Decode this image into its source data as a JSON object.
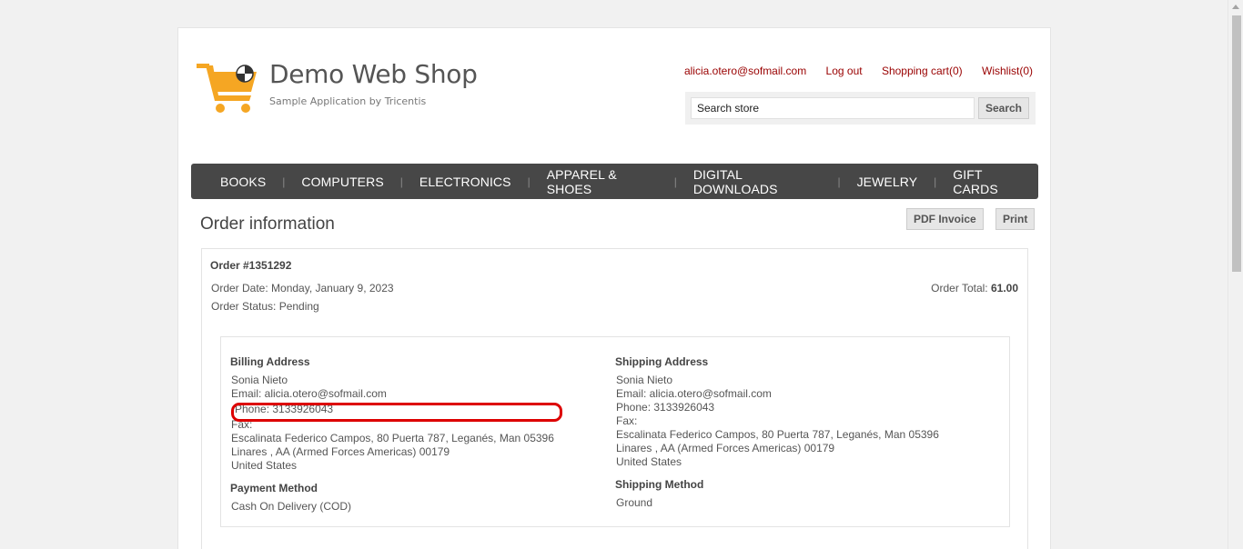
{
  "brand": {
    "title": "Demo Web Shop",
    "subtitle": "Sample Application by Tricentis",
    "logo_icon": "shopping-cart-icon",
    "accent_color": "#f5a623"
  },
  "header": {
    "account_email": "alicia.otero@sofmail.com",
    "logout": "Log out",
    "cart": "Shopping cart(0)",
    "wishlist": "Wishlist(0)",
    "link_color": "#990000"
  },
  "search": {
    "value": "Search store",
    "button": "Search"
  },
  "menu": {
    "items": [
      {
        "label": "BOOKS"
      },
      {
        "label": "COMPUTERS"
      },
      {
        "label": "ELECTRONICS"
      },
      {
        "label": "APPAREL & SHOES"
      },
      {
        "label": "DIGITAL DOWNLOADS"
      },
      {
        "label": "JEWELRY"
      },
      {
        "label": "GIFT CARDS"
      }
    ],
    "separator": "|"
  },
  "order": {
    "page_title": "Order information",
    "pdf_button": "PDF Invoice",
    "print_button": "Print",
    "number": "Order #1351292",
    "date": "Order Date: Monday, January 9, 2023",
    "status": "Order Status: Pending",
    "total_label": "Order Total: ",
    "total_value": "61.00"
  },
  "billing": {
    "heading": "Billing Address",
    "name": "Sonia Nieto",
    "email": "Email: alicia.otero@sofmail.com",
    "phone": "Phone: 3133926043",
    "fax": "Fax:",
    "address1": "Escalinata Federico Campos, 80 Puerta 787, Leganés, Man 05396",
    "address2": "Linares , AA (Armed Forces Americas) 00179",
    "country": "United States",
    "payment_heading": "Payment Method",
    "payment_method": "Cash On Delivery (COD)"
  },
  "shipping": {
    "heading": "Shipping Address",
    "name": "Sonia Nieto",
    "email": "Email: alicia.otero@sofmail.com",
    "phone": "Phone: 3133926043",
    "fax": "Fax:",
    "address1": "Escalinata Federico Campos, 80 Puerta 787, Leganés, Man 05396",
    "address2": "Linares , AA (Armed Forces Americas) 00179",
    "country": "United States",
    "method_heading": "Shipping Method",
    "method": "Ground"
  },
  "annotation": {
    "highlight_color": "#dd0000"
  }
}
